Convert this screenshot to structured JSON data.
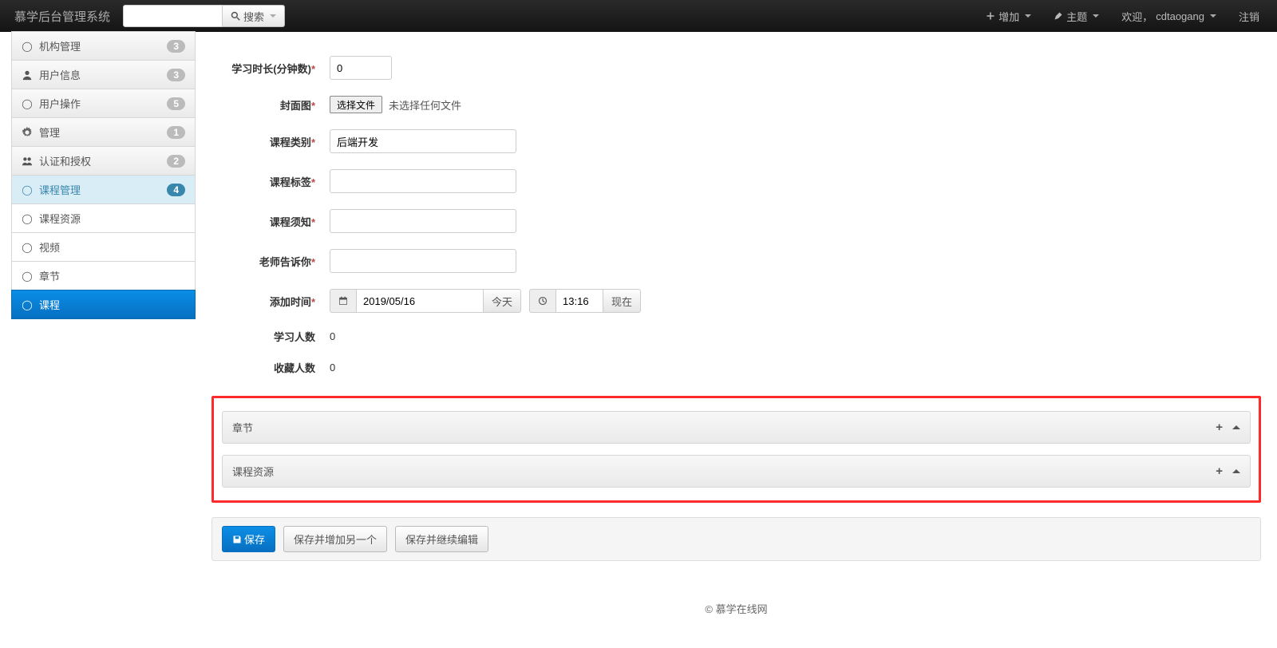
{
  "navbar": {
    "brand": "慕学后台管理系统",
    "search_placeholder": "",
    "search_btn_label": "搜索",
    "add_label": "增加",
    "theme_label": "主题",
    "welcome_prefix": "欢迎，",
    "username": "cdtaogang",
    "logout_label": "注销"
  },
  "sidebar": {
    "items": [
      {
        "icon": "circle",
        "label": "机构管理",
        "badge": "3"
      },
      {
        "icon": "user",
        "label": "用户信息",
        "badge": "3"
      },
      {
        "icon": "circle",
        "label": "用户操作",
        "badge": "5"
      },
      {
        "icon": "gear",
        "label": "管理",
        "badge": "1"
      },
      {
        "icon": "group",
        "label": "认证和授权",
        "badge": "2"
      },
      {
        "icon": "circle",
        "label": "课程管理",
        "badge": "4"
      },
      {
        "icon": "circle",
        "label": "课程资源"
      },
      {
        "icon": "circle",
        "label": "视频"
      },
      {
        "icon": "circle",
        "label": "章节"
      },
      {
        "icon": "circle",
        "label": "课程"
      }
    ]
  },
  "form": {
    "duration": {
      "label": "学习时长(分钟数)",
      "value": "0"
    },
    "cover": {
      "label": "封面图",
      "file_btn": "选择文件",
      "file_status": "未选择任何文件"
    },
    "category": {
      "label": "课程类别",
      "value": "后端开发"
    },
    "tag": {
      "label": "课程标签",
      "value": ""
    },
    "notice": {
      "label": "课程须知",
      "value": ""
    },
    "teacher_say": {
      "label": "老师告诉你",
      "value": ""
    },
    "add_time": {
      "label": "添加时间",
      "date": "2019/05/16",
      "today_btn": "今天",
      "time": "13:16",
      "now_btn": "现在"
    },
    "learners": {
      "label": "学习人数",
      "value": "0"
    },
    "favs": {
      "label": "收藏人数",
      "value": "0"
    }
  },
  "inlines": {
    "lesson": "章节",
    "resource": "课程资源"
  },
  "actions": {
    "save": "保存",
    "save_add": "保存并增加另一个",
    "save_continue": "保存并继续编辑"
  },
  "footer": "© 慕学在线网"
}
